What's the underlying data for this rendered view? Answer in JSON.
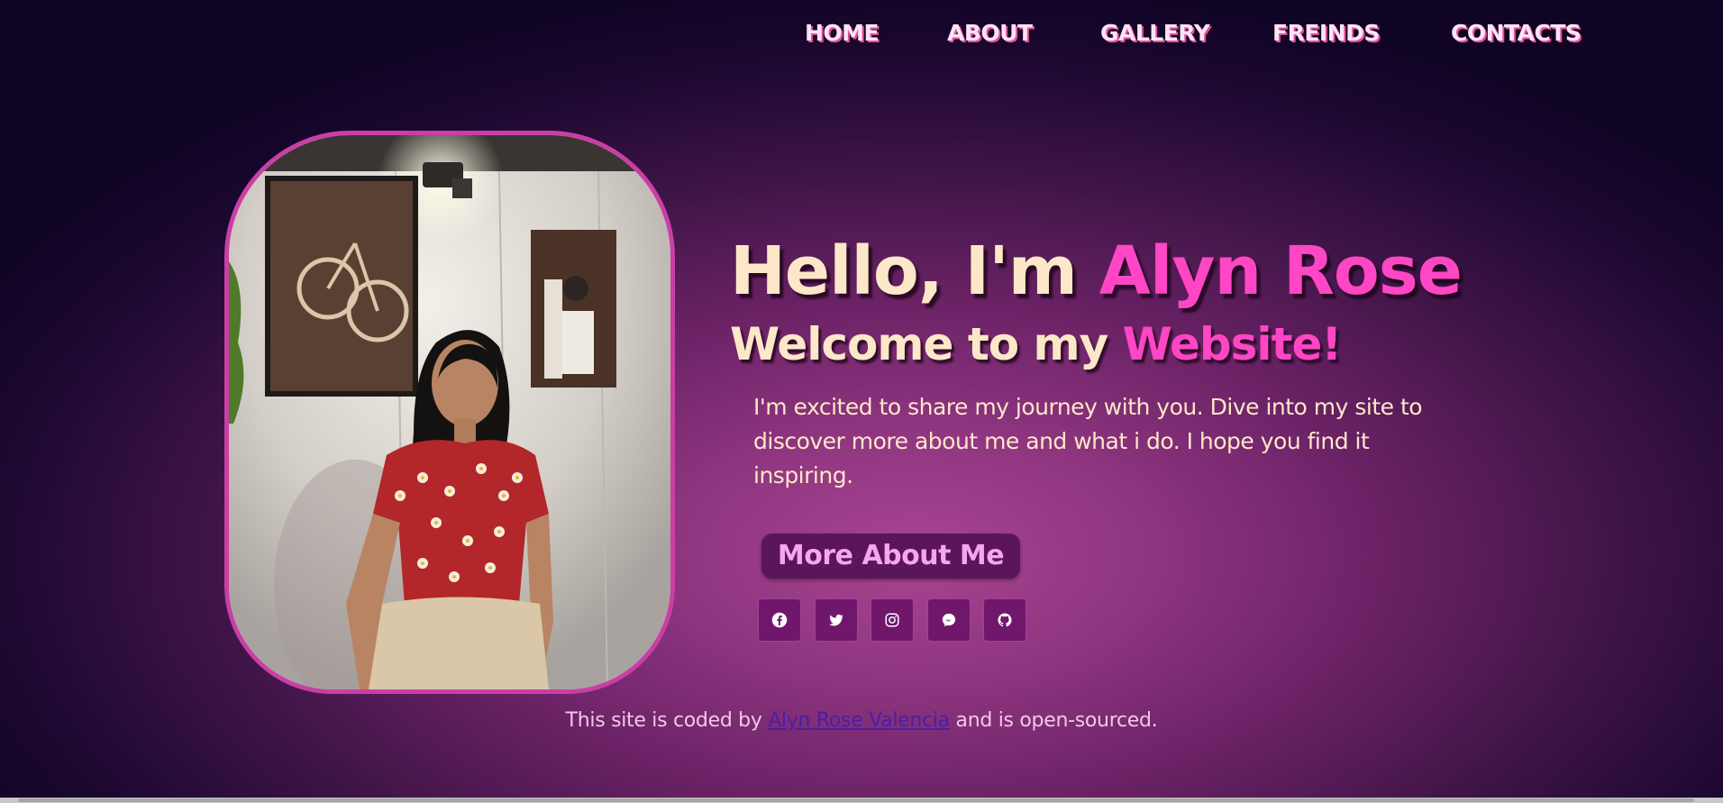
{
  "nav": {
    "home": "HOME",
    "about": "ABOUT",
    "gallery": "GALLERY",
    "friends": "FREINDS",
    "contacts": "CONTACTS"
  },
  "hero": {
    "greeting": "Hello, I'm ",
    "name": "Alyn Rose",
    "welcome": "Welcome to my ",
    "welcome_highlight": "Website!",
    "intro": "I'm excited to share my journey with you. Dive into my site to discover more about me and what i do. I hope you find it inspiring.",
    "cta_label": "More About Me"
  },
  "social": [
    {
      "name": "facebook",
      "icon": "facebook-icon"
    },
    {
      "name": "twitter",
      "icon": "twitter-icon"
    },
    {
      "name": "instagram",
      "icon": "instagram-icon"
    },
    {
      "name": "messenger",
      "icon": "messenger-icon"
    },
    {
      "name": "github",
      "icon": "github-icon"
    }
  ],
  "footer": {
    "prefix": "This site is coded by ",
    "author": "Alyn Rose Valencia",
    "suffix": " and is open-sourced."
  },
  "colors": {
    "accent_pink": "#ff46c4",
    "headline_cream": "#fde7c9",
    "frame_border": "#c93fa5",
    "button_bg": "#5b1559",
    "button_text": "#f6a6ec",
    "social_bg": "#70176c",
    "link_color": "#4a1fa8"
  }
}
